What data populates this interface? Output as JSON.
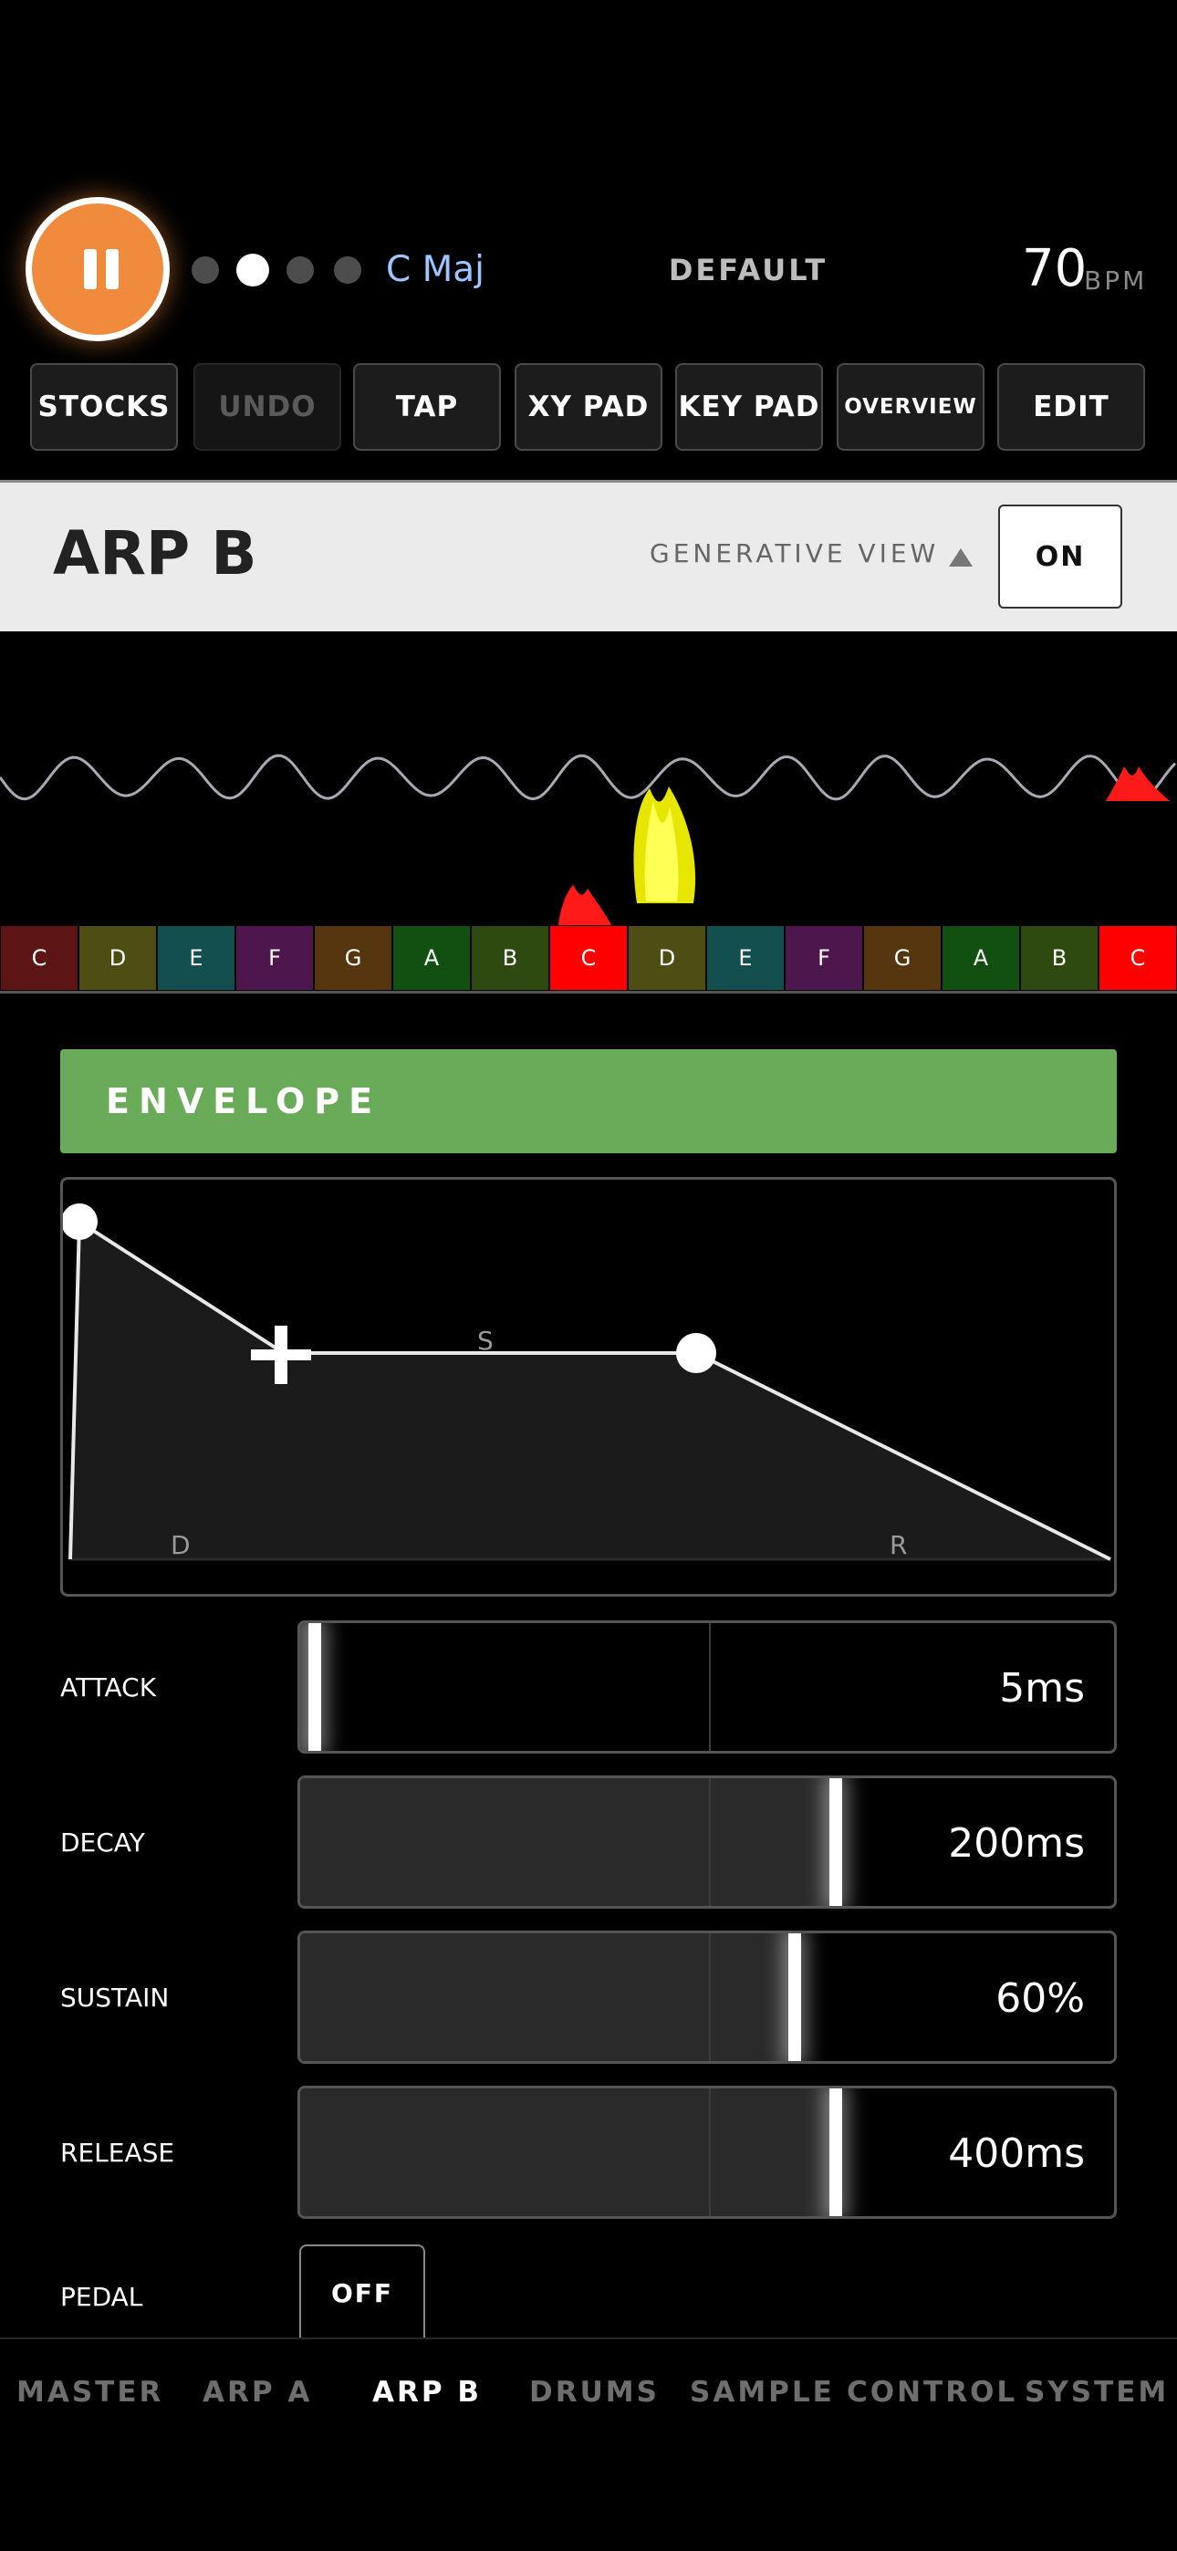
{
  "transport": {
    "pause_label": "II",
    "key": "C Maj",
    "preset": "DEFAULT",
    "bpm": "70",
    "bpm_unit": "BPM",
    "page_dots": 4,
    "active_dot": 1
  },
  "toolbar": {
    "stocks": "STOCKS",
    "undo": "UNDO",
    "tap": "TAP",
    "xy_pad": "XY PAD",
    "key_pad": "KEY PAD",
    "overview": "OVERVIEW",
    "edit": "EDIT"
  },
  "header": {
    "title": "ARP B",
    "generative_view": "GENERATIVE VIEW",
    "on": "ON"
  },
  "keyboard": {
    "keys": [
      {
        "note": "C",
        "color": "#5c1414"
      },
      {
        "note": "D",
        "color": "#4d4d14"
      },
      {
        "note": "E",
        "color": "#134f4f"
      },
      {
        "note": "F",
        "color": "#4d164d"
      },
      {
        "note": "G",
        "color": "#56360f"
      },
      {
        "note": "A",
        "color": "#125012"
      },
      {
        "note": "B",
        "color": "#2e4a11"
      },
      {
        "note": "C",
        "color": "#ff0000"
      },
      {
        "note": "D",
        "color": "#4d4d14"
      },
      {
        "note": "E",
        "color": "#134f4f"
      },
      {
        "note": "F",
        "color": "#4d164d"
      },
      {
        "note": "G",
        "color": "#56360f"
      },
      {
        "note": "A",
        "color": "#125012"
      },
      {
        "note": "B",
        "color": "#2e4a11"
      },
      {
        "note": "C",
        "color": "#ff0000"
      }
    ]
  },
  "envelope": {
    "title": "ENVELOPE",
    "segment_labels": {
      "decay": "D",
      "sustain": "S",
      "release": "R"
    },
    "params": [
      {
        "label": "ATTACK",
        "value": "5ms",
        "level": 0.01
      },
      {
        "label": "DECAY",
        "value": "200ms",
        "level": 0.65
      },
      {
        "label": "SUSTAIN",
        "value": "60%",
        "level": 0.6
      },
      {
        "label": "RELEASE",
        "value": "400ms",
        "level": 0.65
      }
    ],
    "pedal_label": "PEDAL",
    "pedal_value": "OFF"
  },
  "nav": {
    "items": [
      "MASTER",
      "ARP A",
      "ARP B",
      "DRUMS",
      "SAMPLE",
      "CONTROL",
      "SYSTEM"
    ],
    "active": "ARP B"
  },
  "colors": {
    "accent_orange": "#f08a3c",
    "envelope_green": "#6aab59",
    "key_label": "#9ec5ff",
    "flame_yellow": "#f2f21a",
    "flame_red": "#ff0000"
  }
}
